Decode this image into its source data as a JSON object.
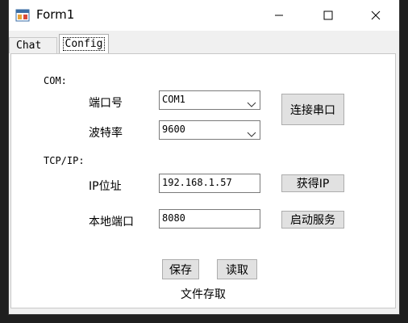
{
  "window": {
    "title": "Form1"
  },
  "tabs": [
    {
      "label": "Chat"
    },
    {
      "label": "Config"
    }
  ],
  "serial": {
    "section_label": "COM:",
    "port_label": "端口号",
    "port_value": "COM1",
    "baud_label": "波特率",
    "baud_value": "9600",
    "connect_button": "连接串口"
  },
  "tcp": {
    "section_label": "TCP/IP:",
    "ip_label": "IP位址",
    "ip_value": "192.168.1.57",
    "get_ip_button": "获得IP",
    "port_label": "本地端口",
    "port_value": "8080",
    "start_button": "启动服务"
  },
  "file": {
    "save_button": "保存",
    "load_button": "读取",
    "caption": "文件存取"
  }
}
